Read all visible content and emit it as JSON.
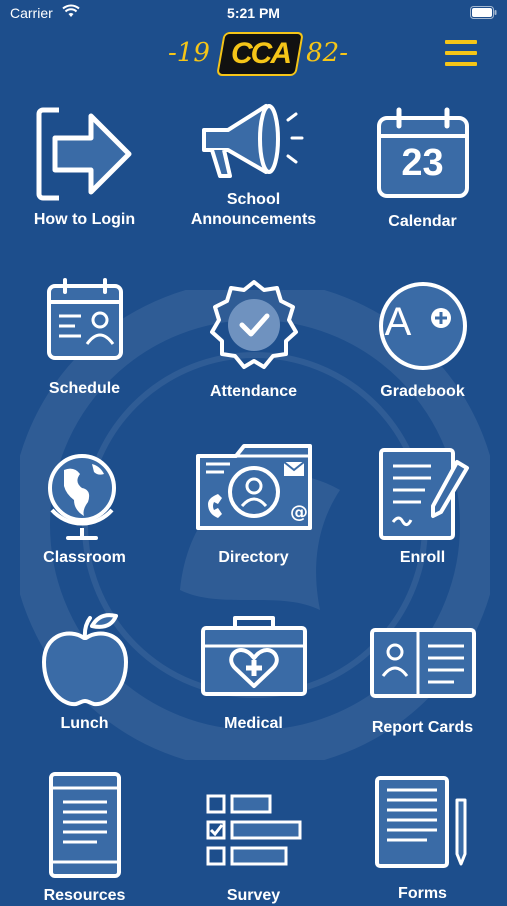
{
  "status_bar": {
    "carrier": "Carrier",
    "time": "5:21 PM"
  },
  "header": {
    "logo_year_left": "-19",
    "logo_text": "CCA",
    "logo_year_right": "82-"
  },
  "colors": {
    "background": "#1d4e8c",
    "accent": "#f5c518",
    "icon_fill": "#3a6ba6"
  },
  "tiles": [
    {
      "label": "How to Login",
      "icon": "login-arrow-icon"
    },
    {
      "label": "School\nAnnouncements",
      "icon": "megaphone-icon"
    },
    {
      "label": "Calendar",
      "icon": "calendar-icon",
      "calendar_day": "23"
    },
    {
      "label": "Schedule",
      "icon": "schedule-icon"
    },
    {
      "label": "Attendance",
      "icon": "attendance-badge-icon"
    },
    {
      "label": "Gradebook",
      "icon": "grade-a-plus-icon",
      "grade_text": "A"
    },
    {
      "label": "Classroom",
      "icon": "globe-icon"
    },
    {
      "label": "Directory",
      "icon": "directory-folder-icon"
    },
    {
      "label": "Enroll",
      "icon": "enroll-document-icon"
    },
    {
      "label": "Lunch",
      "icon": "apple-icon"
    },
    {
      "label": "Medical",
      "icon": "medical-kit-icon"
    },
    {
      "label": "Report Cards",
      "icon": "report-card-icon"
    },
    {
      "label": "Resources",
      "icon": "tablet-document-icon"
    },
    {
      "label": "Survey",
      "icon": "survey-checklist-icon"
    },
    {
      "label": "Forms",
      "icon": "forms-document-icon"
    }
  ]
}
